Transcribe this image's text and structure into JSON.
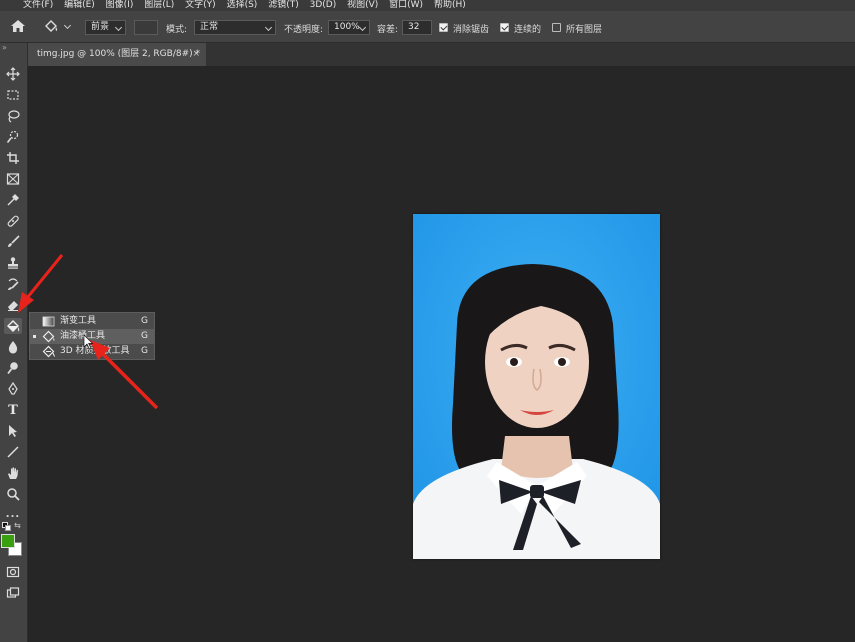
{
  "menubar": {
    "items": [
      "文件(F)",
      "编辑(E)",
      "图像(I)",
      "图层(L)",
      "文字(Y)",
      "选择(S)",
      "滤镜(T)",
      "3D(D)",
      "视图(V)",
      "窗口(W)",
      "帮助(H)"
    ]
  },
  "options": {
    "fill_source": "前景",
    "mode_label": "模式:",
    "mode_value": "正常",
    "opacity_label": "不透明度:",
    "opacity_value": "100%",
    "tolerance_label": "容差:",
    "tolerance_value": "32",
    "antialias_label": "消除锯齿",
    "antialias_checked": true,
    "contiguous_label": "连续的",
    "contiguous_checked": true,
    "all_layers_label": "所有图层",
    "all_layers_checked": false
  },
  "document": {
    "tab_title": "timg.jpg @ 100% (图层 2, RGB/8#) *",
    "close_glyph": "×"
  },
  "flyout": {
    "items": [
      {
        "label": "渐变工具",
        "shortcut": "G",
        "icon": "gradient-icon",
        "selected": false
      },
      {
        "label": "油漆桶工具",
        "shortcut": "G",
        "icon": "paint-bucket-icon",
        "selected": true
      },
      {
        "label": "3D 材质拖放工具",
        "shortcut": "G",
        "icon": "3d-material-drop-icon",
        "selected": false
      }
    ]
  },
  "toolbar": {
    "tools": [
      "move-icon",
      "marquee-icon",
      "lasso-icon",
      "quick-select-icon",
      "crop-icon",
      "frame-icon",
      "eyedropper-icon",
      "healing-icon",
      "brush-icon",
      "stamp-icon",
      "history-brush-icon",
      "eraser-icon",
      "paint-bucket-icon",
      "blur-icon",
      "dodge-icon",
      "pen-icon",
      "type-icon",
      "path-select-icon",
      "line-icon",
      "hand-icon",
      "zoom-icon",
      "more-icon"
    ],
    "type_glyph": "T",
    "more_glyph": "...",
    "foreground_color": "#3aa00f",
    "background_color": "#ffffff"
  },
  "colors": {
    "photo_background": "#2aa0ef",
    "annotation_arrow": "#e8231b"
  }
}
